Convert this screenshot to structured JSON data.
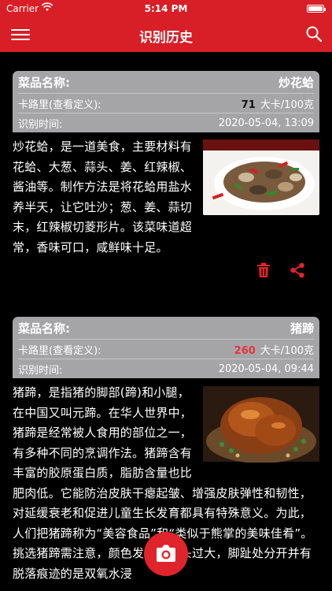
{
  "status": {
    "carrier": "Carrier",
    "time": "5:14 PM"
  },
  "header": {
    "title": "识别历史",
    "menu_icon": "hamburger-menu-icon",
    "search_icon": "search-icon"
  },
  "records": [
    {
      "name_label": "菜品名称:",
      "name": "炒花蛤",
      "calorie_label": "卡路里(查看定义):",
      "calorie_value": "71",
      "calorie_unit": "大卡/100克",
      "time_label": "识别时间:",
      "time": "2020-05-04, 13:09",
      "description": "炒花蛤，是一道美食，主要材料有花蛤、大葱、蒜头、姜、红辣椒、酱油等。制作方法是将花蛤用盐水养半天，让它吐沙；葱、姜、蒜切末，红辣椒切菱形片。该菜味道超常，香味可口，咸鲜味十足。",
      "delete_icon": "trash-icon",
      "share_icon": "share-icon",
      "calorie_color": "#111111"
    },
    {
      "name_label": "菜品名称:",
      "name": "猪蹄",
      "calorie_label": "卡路里(查看定义):",
      "calorie_value": "260",
      "calorie_unit": "大卡/100克",
      "time_label": "识别时间:",
      "time": "2020-05-04, 09:44",
      "description": "猪蹄，是指猪的脚部(蹄)和小腿，在中国又叫元蹄。在华人世界中，猪蹄是经常被人食用的部位之一，有多种不同的烹调作法。猪蹄含有丰富的胶原蛋白质，脂肪含量也比肥肉低。它能防治皮肤干瘪起皱、增强皮肤弹性和韧性，对延缓衰老和促进儿童生长发育都具有特殊意义。为此，人们把猪蹄称为“美容食品”和“类似于熊掌的美味佳肴”。挑选猪蹄需注意，颜色发白，个头过大，脚趾处分开并有脱落痕迹的是双氧水浸",
      "calorie_color": "#e8323a"
    }
  ],
  "fab": {
    "icon": "camera-icon"
  },
  "colors": {
    "brand_red": "#d81e26",
    "card_header": "#a5a5a8",
    "background": "#000000"
  }
}
